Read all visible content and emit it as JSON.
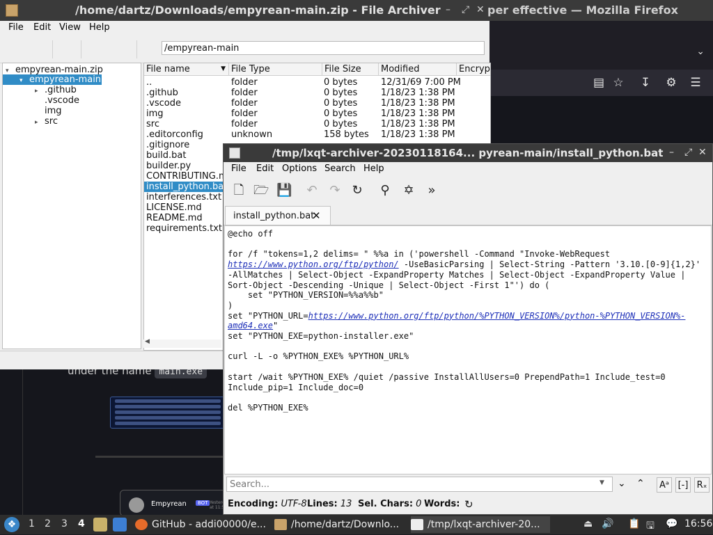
{
  "firefox": {
    "title": "per effective — Mozilla Firefox",
    "under_text": "under the name",
    "under_code": "main.exe",
    "card_name": "Empyrean",
    "card_badge": "BOT",
    "card_time": "Yesterday at 11:56"
  },
  "archiver": {
    "title": "/home/dartz/Downloads/empyrean-main.zip - File Archiver",
    "menu": [
      "File",
      "Edit",
      "View",
      "Help"
    ],
    "path": "/empyrean-main",
    "tree": [
      {
        "label": "empyrean-main.zip",
        "arrow": "▾"
      },
      {
        "label": "empyrean-main",
        "arrow": "▾"
      },
      {
        "label": ".github",
        "arrow": "▸"
      },
      {
        "label": ".vscode",
        "arrow": ""
      },
      {
        "label": "img",
        "arrow": ""
      },
      {
        "label": "src",
        "arrow": "▸"
      }
    ],
    "columns": [
      "File name",
      "File Type",
      "File Size",
      "Modified",
      "Encrypted"
    ],
    "files": [
      {
        "name": "..",
        "type": "folder",
        "size": "0 bytes",
        "modified": "12/31/69 7:00 PM"
      },
      {
        "name": ".github",
        "type": "folder",
        "size": "0 bytes",
        "modified": "1/18/23 1:38 PM"
      },
      {
        "name": ".vscode",
        "type": "folder",
        "size": "0 bytes",
        "modified": "1/18/23 1:38 PM"
      },
      {
        "name": "img",
        "type": "folder",
        "size": "0 bytes",
        "modified": "1/18/23 1:38 PM"
      },
      {
        "name": "src",
        "type": "folder",
        "size": "0 bytes",
        "modified": "1/18/23 1:38 PM"
      },
      {
        "name": ".editorconfig",
        "type": "unknown",
        "size": "158 bytes",
        "modified": "1/18/23 1:38 PM"
      },
      {
        "name": ".gitignore",
        "type": "",
        "size": "",
        "modified": ""
      },
      {
        "name": "build.bat",
        "type": "",
        "size": "",
        "modified": ""
      },
      {
        "name": "builder.py",
        "type": "",
        "size": "",
        "modified": ""
      },
      {
        "name": "CONTRIBUTING.md",
        "type": "",
        "size": "",
        "modified": ""
      },
      {
        "name": "install_python.bat",
        "type": "",
        "size": "",
        "modified": ""
      },
      {
        "name": "interferences.txt",
        "type": "",
        "size": "",
        "modified": ""
      },
      {
        "name": "LICENSE.md",
        "type": "",
        "size": "",
        "modified": ""
      },
      {
        "name": "README.md",
        "type": "",
        "size": "",
        "modified": ""
      },
      {
        "name": "requirements.txt",
        "type": "",
        "size": "",
        "modified": ""
      }
    ]
  },
  "editor": {
    "title": "/tmp/lxqt-archiver-20230118164...   pyrean-main/install_python.bat",
    "menu": [
      "File",
      "Edit",
      "Options",
      "Search",
      "Help"
    ],
    "tab_label": "install_python.bat",
    "code": {
      "l1": "@echo off",
      "l2a": "for /f \"tokens=1,2 delims= \" %%a in ('powershell -Command \"Invoke-WebRequest ",
      "l2link": "https://www.python.org/ftp/python/",
      "l2b": " -UseBasicParsing | Select-String -Pattern '3.10.[0-9]{1,2}' -AllMatches | Select-Object -ExpandProperty Matches | Select-Object -ExpandProperty Value | Sort-Object -Descending -Unique | Select-Object -First 1\"') do (",
      "l3": "    set \"PYTHON_VERSION=%%a%%b\"",
      "l4": ")",
      "l5a": "set \"PYTHON_URL=",
      "l5link": "https://www.python.org/ftp/python/%PYTHON_VERSION%/python-%PYTHON_VERSION%-amd64.exe",
      "l5b": "\"",
      "l6": "set \"PYTHON_EXE=python-installer.exe\"",
      "l7": "curl -L -o %PYTHON_EXE% %PYTHON_URL%",
      "l8": "start /wait %PYTHON_EXE% /quiet /passive InstallAllUsers=0 PrependPath=1 Include_test=0 Include_pip=1 Include_doc=0",
      "l9": "del %PYTHON_EXE%"
    },
    "search_placeholder": "Search...",
    "status": {
      "encoding_label": "Encoding:",
      "encoding": "UTF-8",
      "lines_label": "Lines:",
      "lines": "13",
      "sel_label": "Sel. Chars:",
      "sel": "0",
      "words_label": "Words:"
    }
  },
  "taskbar": {
    "desktops": [
      "1",
      "2",
      "3",
      "4"
    ],
    "active_desktop": "4",
    "tasks": [
      {
        "label": "GitHub - addi00000/e..."
      },
      {
        "label": "/home/dartz/Downlo..."
      },
      {
        "label": "/tmp/lxqt-archiver-20..."
      }
    ],
    "clock": "16:56"
  }
}
